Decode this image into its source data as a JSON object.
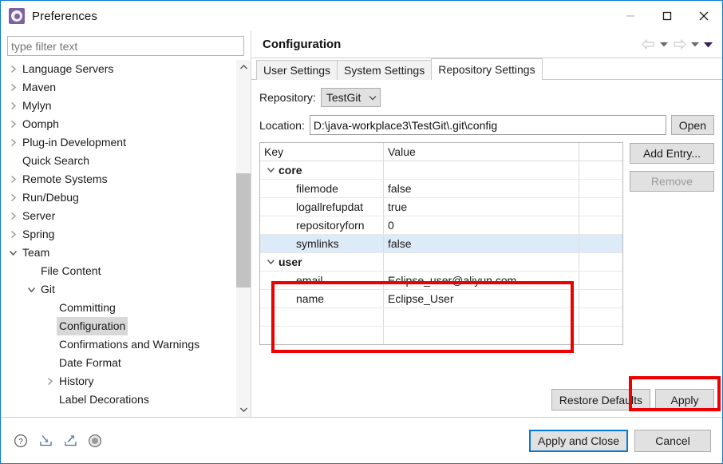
{
  "window": {
    "title": "Preferences",
    "app_icon": "gear-icon",
    "controls": {
      "minimize": "minimize-icon",
      "maximize": "maximize-icon",
      "close": "close-icon"
    }
  },
  "sidebar": {
    "filter": {
      "value": "",
      "placeholder": "type filter text"
    },
    "items": [
      {
        "label": "Language Servers",
        "indent": 0,
        "twisty": "collapsed",
        "selected": false
      },
      {
        "label": "Maven",
        "indent": 0,
        "twisty": "collapsed",
        "selected": false
      },
      {
        "label": "Mylyn",
        "indent": 0,
        "twisty": "collapsed",
        "selected": false
      },
      {
        "label": "Oomph",
        "indent": 0,
        "twisty": "collapsed",
        "selected": false
      },
      {
        "label": "Plug-in Development",
        "indent": 0,
        "twisty": "collapsed",
        "selected": false
      },
      {
        "label": "Quick Search",
        "indent": 0,
        "twisty": "none",
        "selected": false
      },
      {
        "label": "Remote Systems",
        "indent": 0,
        "twisty": "collapsed",
        "selected": false
      },
      {
        "label": "Run/Debug",
        "indent": 0,
        "twisty": "collapsed",
        "selected": false
      },
      {
        "label": "Server",
        "indent": 0,
        "twisty": "collapsed",
        "selected": false
      },
      {
        "label": "Spring",
        "indent": 0,
        "twisty": "collapsed",
        "selected": false
      },
      {
        "label": "Team",
        "indent": 0,
        "twisty": "expanded",
        "selected": false
      },
      {
        "label": "File Content",
        "indent": 1,
        "twisty": "none",
        "selected": false
      },
      {
        "label": "Git",
        "indent": 1,
        "twisty": "expanded",
        "selected": false
      },
      {
        "label": "Committing",
        "indent": 2,
        "twisty": "none",
        "selected": false
      },
      {
        "label": "Configuration",
        "indent": 2,
        "twisty": "none",
        "selected": true
      },
      {
        "label": "Confirmations and Warnings",
        "indent": 2,
        "twisty": "none",
        "selected": false
      },
      {
        "label": "Date Format",
        "indent": 2,
        "twisty": "none",
        "selected": false
      },
      {
        "label": "History",
        "indent": 2,
        "twisty": "collapsed",
        "selected": false
      },
      {
        "label": "Label Decorations",
        "indent": 2,
        "twisty": "none",
        "selected": false
      }
    ],
    "scrollbar": {
      "up": "chevron-up-icon",
      "down": "chevron-down-icon"
    }
  },
  "page": {
    "title": "Configuration",
    "nav": {
      "back": "arrow-left-icon",
      "back_menu": "caret-down-icon",
      "forward": "arrow-right-icon",
      "forward_menu": "caret-down-icon",
      "view_menu": "caret-down-icon"
    },
    "tabs": [
      {
        "label": "User Settings",
        "selected": false
      },
      {
        "label": "System Settings",
        "selected": false
      },
      {
        "label": "Repository Settings",
        "selected": true
      }
    ],
    "repository": {
      "label": "Repository:",
      "value": "TestGit",
      "caret": "caret-down-icon"
    },
    "location": {
      "label": "Location:",
      "value": "D:\\java-workplace3\\TestGit\\.git\\config",
      "open_button": "Open"
    },
    "table": {
      "columns": [
        "Key",
        "Value",
        ""
      ],
      "rows": [
        {
          "type": "section",
          "key": "core",
          "value": "",
          "twisty": "expanded",
          "selected": false
        },
        {
          "type": "entry",
          "key": "filemode",
          "value": "false",
          "selected": false
        },
        {
          "type": "entry",
          "key": "logallrefupdat",
          "value": "true",
          "selected": false
        },
        {
          "type": "entry",
          "key": "repositoryforn",
          "value": "0",
          "selected": false
        },
        {
          "type": "entry",
          "key": "symlinks",
          "value": "false",
          "selected": true
        },
        {
          "type": "section",
          "key": "user",
          "value": "",
          "twisty": "expanded",
          "selected": false
        },
        {
          "type": "entry",
          "key": "email",
          "value": "Eclipse_user@aliyun.com",
          "selected": false
        },
        {
          "type": "entry",
          "key": "name",
          "value": "Eclipse_User",
          "selected": false
        },
        {
          "type": "blank",
          "key": "",
          "value": "",
          "selected": false
        },
        {
          "type": "blank",
          "key": "",
          "value": "",
          "selected": false
        }
      ]
    },
    "side_buttons": {
      "add_entry": "Add Entry...",
      "remove": "Remove"
    },
    "bottom_buttons": {
      "restore_defaults": "Restore Defaults",
      "apply": "Apply"
    }
  },
  "footer": {
    "icons": [
      {
        "name": "help-icon"
      },
      {
        "name": "import-icon"
      },
      {
        "name": "export-icon"
      },
      {
        "name": "record-icon"
      }
    ],
    "apply_and_close": "Apply and Close",
    "cancel": "Cancel"
  },
  "annotations": {
    "color": "#ee0000",
    "boxes": [
      {
        "name": "user-section-highlight"
      },
      {
        "name": "apply-button-highlight"
      }
    ]
  }
}
